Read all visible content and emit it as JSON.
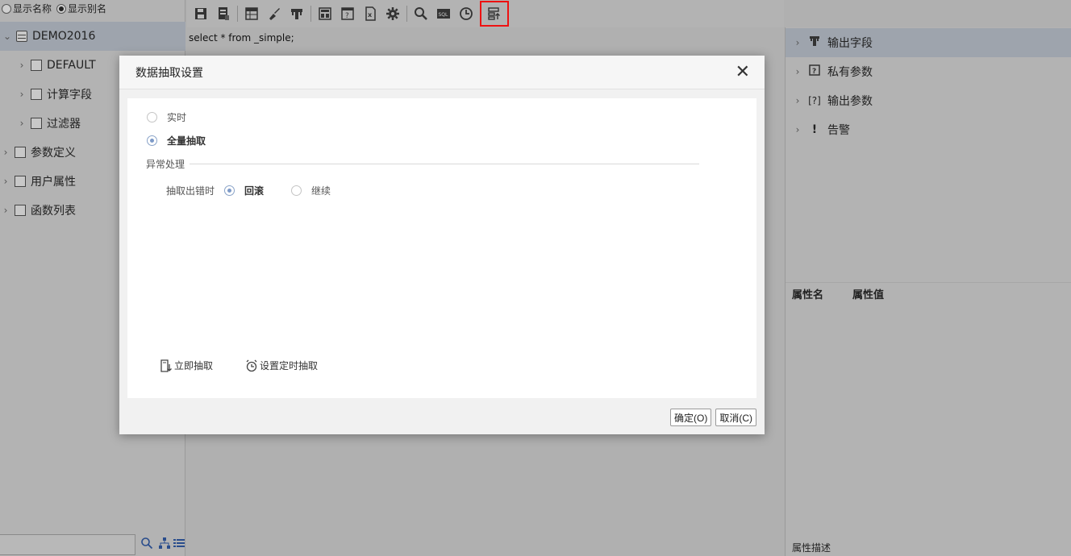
{
  "left": {
    "name_options": [
      {
        "label": "显示名称",
        "selected": false
      },
      {
        "label": "显示别名",
        "selected": true
      }
    ],
    "tree": [
      {
        "label": "DEMO2016",
        "level": 0,
        "expanded": true,
        "icon": "database-icon"
      },
      {
        "label": "DEFAULT",
        "level": 1,
        "icon": "table-icon"
      },
      {
        "label": "计算字段",
        "level": 1,
        "icon": "calc-icon"
      },
      {
        "label": "过滤器",
        "level": 1,
        "icon": "filter-icon"
      },
      {
        "label": "参数定义",
        "level": 0,
        "icon": "param-icon"
      },
      {
        "label": "用户属性",
        "level": 0,
        "icon": "user-attr-icon"
      },
      {
        "label": "函数列表",
        "level": 0,
        "icon": "function-icon"
      }
    ]
  },
  "toolbar": {
    "buttons": [
      "save-icon",
      "save-as-icon",
      "table-icon",
      "brush-icon",
      "field-icon",
      "layout-icon",
      "param-window-icon",
      "excel-icon",
      "gear-icon",
      "search-icon",
      "sql-icon",
      "clock-icon",
      "extract-icon"
    ]
  },
  "editor": {
    "sql": "select * from _simple;"
  },
  "right": {
    "items": [
      {
        "label": "输出字段",
        "icon": "T"
      },
      {
        "label": "私有参数",
        "icon": "?"
      },
      {
        "label": "输出参数",
        "icon": "[?]"
      },
      {
        "label": "告警",
        "icon": "!"
      }
    ],
    "prop_name": "属性名",
    "prop_value": "属性值",
    "prop_desc": "属性描述"
  },
  "dialog": {
    "title": "数据抽取设置",
    "opt_realtime": "实时",
    "opt_full": "全量抽取",
    "section_exception": "异常处理",
    "on_error_label": "抽取出错时",
    "opt_rollback": "回滚",
    "opt_continue": "继续",
    "action_extract_now": "立即抽取",
    "action_schedule": "设置定时抽取",
    "ok": "确定(O)",
    "cancel": "取消(C)"
  },
  "colors": {
    "selected_row": "#9ea4ad",
    "highlight_box": "#e11111",
    "radio_accent": "#7d9ac8"
  }
}
